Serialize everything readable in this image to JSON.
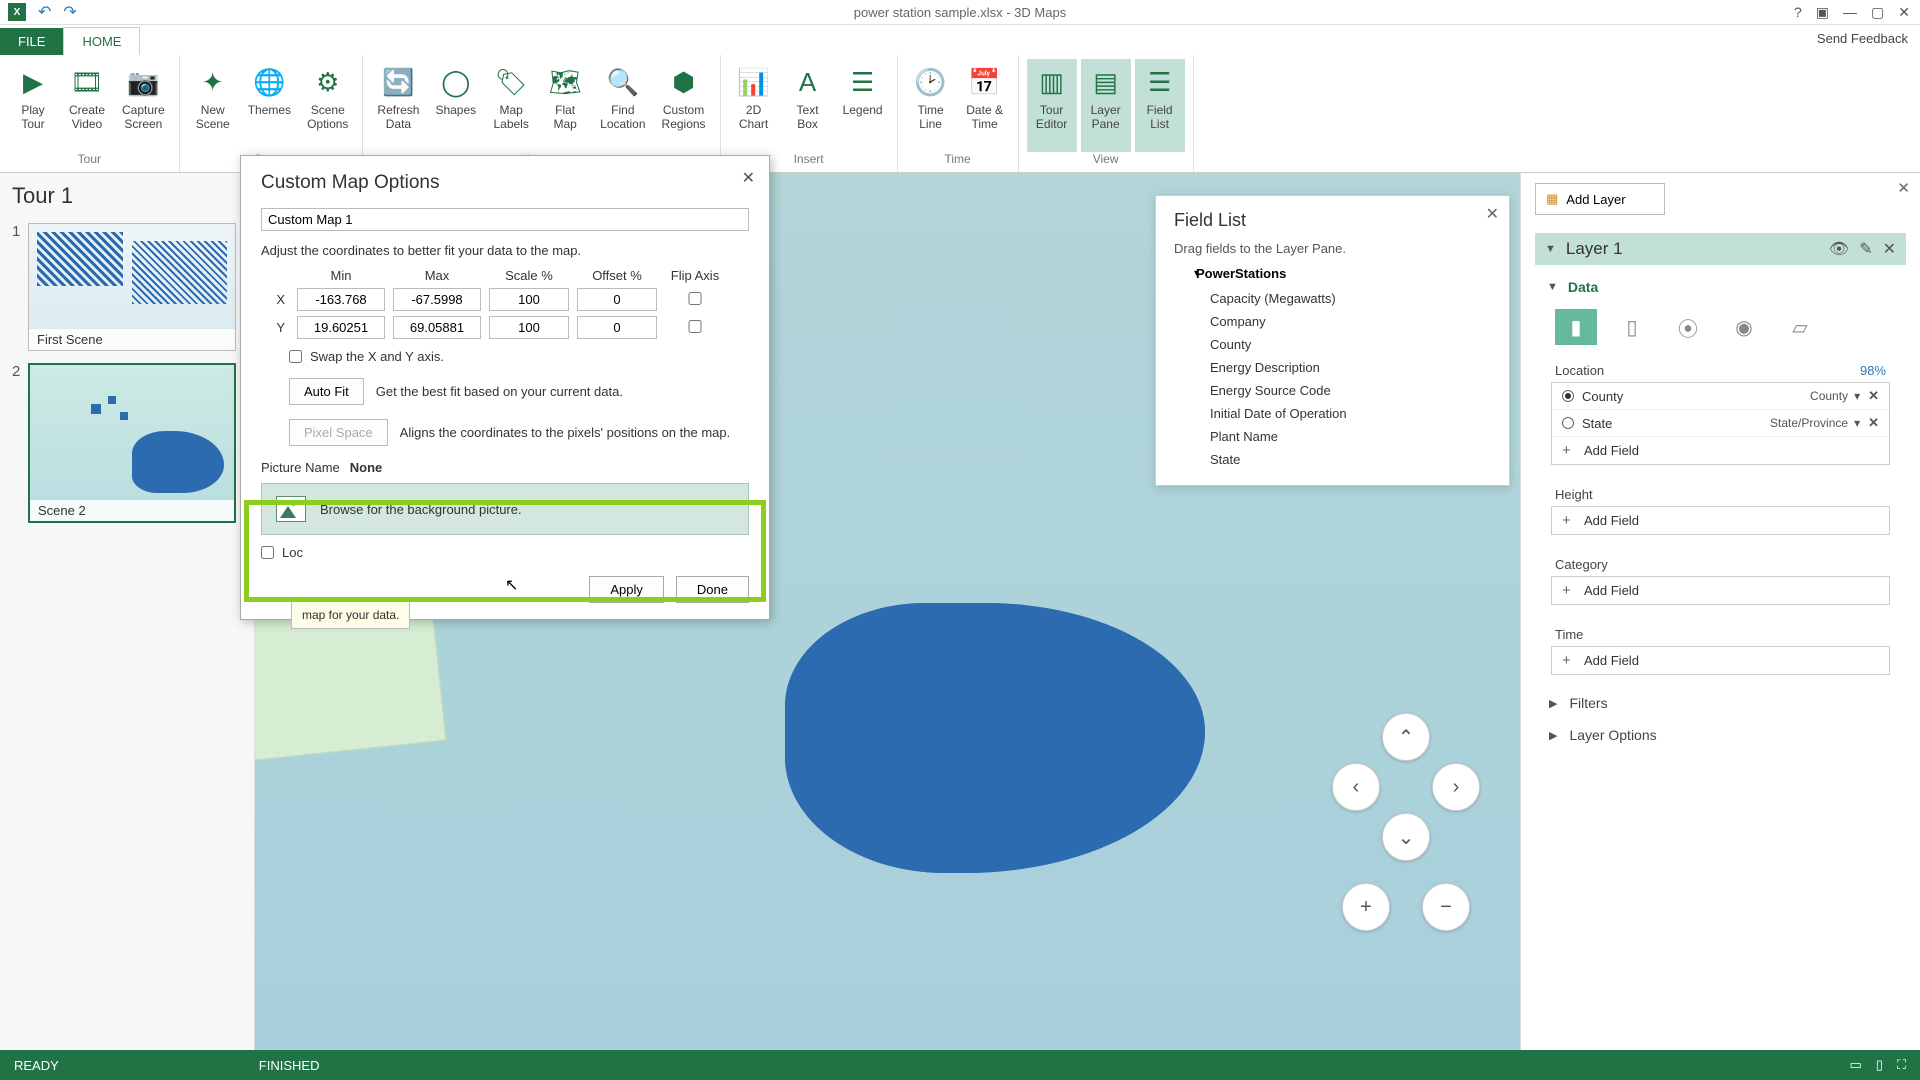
{
  "titlebar": {
    "app": "X",
    "title": "power station sample.xlsx - 3D Maps"
  },
  "tabs": {
    "file": "FILE",
    "home": "HOME",
    "feedback": "Send Feedback"
  },
  "ribbon": {
    "tour": {
      "label": "Tour",
      "play": "Play\nTour",
      "video": "Create\nVideo",
      "capture": "Capture\nScreen"
    },
    "scene": {
      "new": "New\nScene",
      "themes": "Themes",
      "options": "Scene\nOptions"
    },
    "map": {
      "refresh": "Refresh\nData",
      "shapes": "Shapes",
      "labels": "Map\nLabels",
      "flat": "Flat\nMap",
      "find": "Find\nLocation",
      "custom": "Custom\nRegions"
    },
    "insert": {
      "label": "Insert",
      "chart": "2D\nChart",
      "text": "Text\nBox",
      "legend": "Legend"
    },
    "time": {
      "label": "Time",
      "timeline": "Time\nLine",
      "datetime": "Date &\nTime"
    },
    "view": {
      "label": "View",
      "editor": "Tour\nEditor",
      "layer": "Layer\nPane",
      "field": "Field\nList"
    }
  },
  "tour": {
    "title": "Tour 1",
    "scenes": [
      {
        "num": "1",
        "name": "First Scene"
      },
      {
        "num": "2",
        "name": "Scene 2"
      }
    ]
  },
  "dialog": {
    "title": "Custom Map Options",
    "name": "Custom Map 1",
    "explain": "Adjust the coordinates to better fit your data to the map.",
    "hdr": {
      "min": "Min",
      "max": "Max",
      "scale": "Scale %",
      "offset": "Offset %",
      "flip": "Flip Axis"
    },
    "x": {
      "lbl": "X",
      "min": "-163.768",
      "max": "-67.5998",
      "scale": "100",
      "offset": "0"
    },
    "y": {
      "lbl": "Y",
      "min": "19.60251",
      "max": "69.05881",
      "scale": "100",
      "offset": "0"
    },
    "swap": "Swap the X and Y axis.",
    "autofit": "Auto Fit",
    "autofit_desc": "Get the best fit based on your current data.",
    "pixel": "Pixel Space",
    "pixel_desc": "Aligns the coordinates to the pixels' positions on the map.",
    "pic_label": "Picture Name",
    "pic_value": "None",
    "browse": "Browse for the background picture.",
    "lock": "Loc",
    "tooltip": "map for your data.",
    "apply": "Apply",
    "done": "Done"
  },
  "fieldlist": {
    "title": "Field List",
    "hint": "Drag fields to the Layer Pane.",
    "table": "PowerStations",
    "fields": [
      "Capacity (Megawatts)",
      "Company",
      "County",
      "Energy Description",
      "Energy Source Code",
      "Initial Date of Operation",
      "Plant Name",
      "State"
    ]
  },
  "layerpane": {
    "add": "Add Layer",
    "layer": "Layer 1",
    "data": "Data",
    "location": "Location",
    "location_pct": "98%",
    "rows": [
      {
        "name": "County",
        "type": "County"
      },
      {
        "name": "State",
        "type": "State/Province"
      }
    ],
    "addfield": "Add Field",
    "height": "Height",
    "category": "Category",
    "time": "Time",
    "filters": "Filters",
    "layeroptions": "Layer Options"
  },
  "status": {
    "ready": "READY",
    "finished": "FINISHED"
  }
}
